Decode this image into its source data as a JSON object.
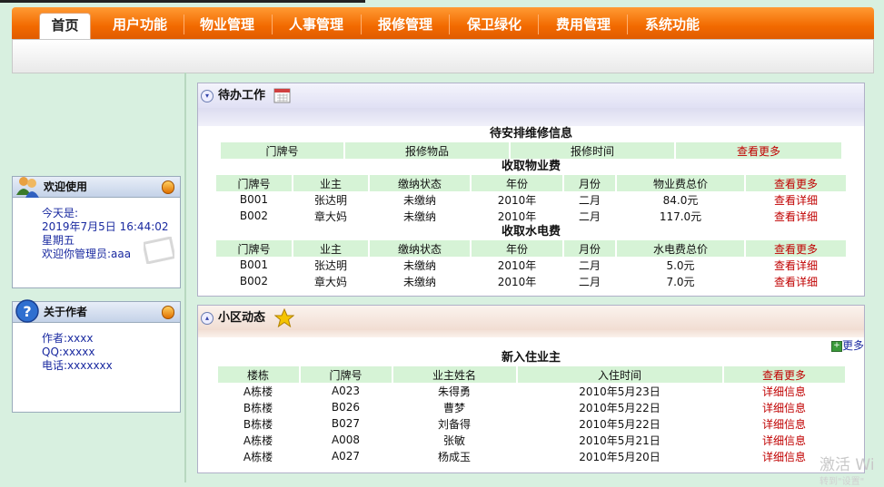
{
  "nav": {
    "tabs": [
      {
        "label": "首页"
      },
      {
        "label": "用户功能"
      },
      {
        "label": "物业管理"
      },
      {
        "label": "人事管理"
      },
      {
        "label": "报修管理"
      },
      {
        "label": "保卫绿化"
      },
      {
        "label": "费用管理"
      },
      {
        "label": "系统功能"
      }
    ]
  },
  "welcome": {
    "title": "欢迎使用",
    "today_label": "今天是:",
    "datetime": "2019年7月5日  16:44:02",
    "weekday": "星期五",
    "greeting": "欢迎你管理员:aaa"
  },
  "author": {
    "title": "关于作者",
    "name": "作者:xxxx",
    "qq": "QQ:xxxxx",
    "phone": "电话:xxxxxxx"
  },
  "todo": {
    "title": "待办工作",
    "repair": {
      "caption": "待安排维修信息",
      "headers": [
        "门牌号",
        "报修物品",
        "报修时间",
        "查看更多"
      ]
    },
    "property_fee": {
      "caption": "收取物业费",
      "headers": [
        "门牌号",
        "业主",
        "缴纳状态",
        "年份",
        "月份",
        "物业费总价",
        "查看更多"
      ],
      "rows": [
        [
          "B001",
          "张达明",
          "未缴纳",
          "2010年",
          "二月",
          "84.0元",
          "查看详细"
        ],
        [
          "B002",
          "章大妈",
          "未缴纳",
          "2010年",
          "二月",
          "117.0元",
          "查看详细"
        ]
      ]
    },
    "utility_fee": {
      "caption": "收取水电费",
      "headers": [
        "门牌号",
        "业主",
        "缴纳状态",
        "年份",
        "月份",
        "水电费总价",
        "查看更多"
      ],
      "rows": [
        [
          "B001",
          "张达明",
          "未缴纳",
          "2010年",
          "二月",
          "5.0元",
          "查看详细"
        ],
        [
          "B002",
          "章大妈",
          "未缴纳",
          "2010年",
          "二月",
          "7.0元",
          "查看详细"
        ]
      ]
    }
  },
  "news": {
    "title": "小区动态",
    "more": "更多",
    "caption": "新入住业主",
    "headers": [
      "楼栋",
      "门牌号",
      "业主姓名",
      "入住时间",
      "查看更多"
    ],
    "rows": [
      [
        "A栋楼",
        "A023",
        "朱得勇",
        "2010年5月23日",
        "详细信息"
      ],
      [
        "B栋楼",
        "B026",
        "曹梦",
        "2010年5月22日",
        "详细信息"
      ],
      [
        "B栋楼",
        "B027",
        "刘备得",
        "2010年5月22日",
        "详细信息"
      ],
      [
        "A栋楼",
        "A008",
        "张敏",
        "2010年5月21日",
        "详细信息"
      ],
      [
        "A栋楼",
        "A027",
        "杨成玉",
        "2010年5月20日",
        "详细信息"
      ]
    ]
  },
  "watermark": {
    "line1": "激活 Wi",
    "line2": "转到\"设置\""
  }
}
